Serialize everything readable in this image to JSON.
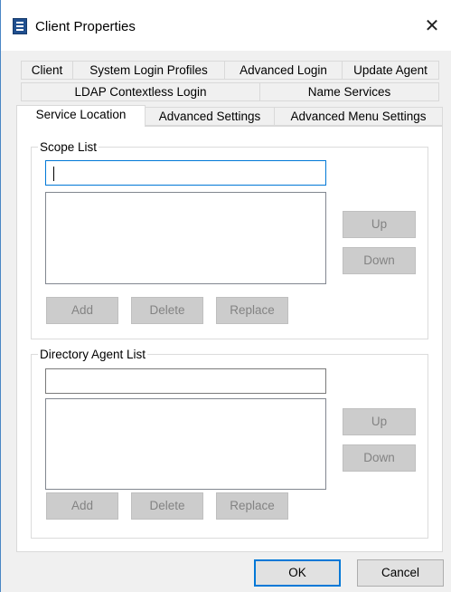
{
  "window": {
    "title": "Client Properties"
  },
  "tabs": {
    "row1": [
      "Client",
      "System Login Profiles",
      "Advanced Login",
      "Update Agent"
    ],
    "row2": [
      "LDAP Contextless Login",
      "Name Services"
    ],
    "row3": [
      "Service Location",
      "Advanced Settings",
      "Advanced Menu Settings"
    ],
    "active": "Service Location"
  },
  "scope_list": {
    "legend": "Scope List",
    "input_value": "",
    "buttons": {
      "up": "Up",
      "down": "Down",
      "add": "Add",
      "delete": "Delete",
      "replace": "Replace"
    }
  },
  "directory_agent_list": {
    "legend": "Directory Agent List",
    "input_value": "",
    "buttons": {
      "up": "Up",
      "down": "Down",
      "add": "Add",
      "delete": "Delete",
      "replace": "Replace"
    }
  },
  "footer": {
    "ok": "OK",
    "cancel": "Cancel"
  },
  "icons": {
    "app": "client-properties-app-icon",
    "close": "close-icon"
  }
}
